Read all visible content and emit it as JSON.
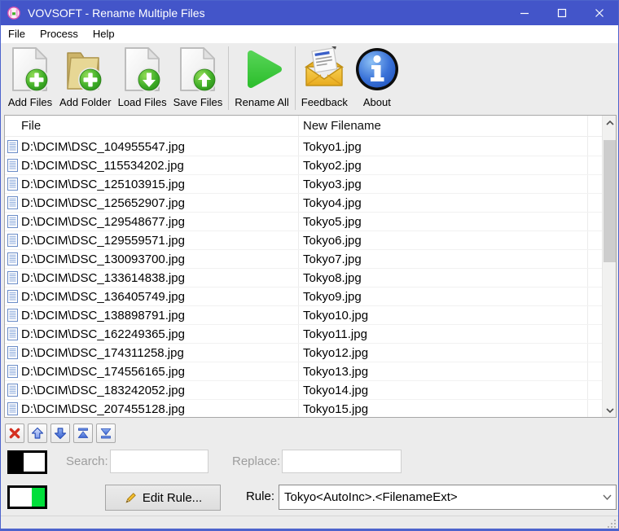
{
  "window": {
    "title": "VOVSOFT - Rename Multiple Files"
  },
  "menu": {
    "items": [
      {
        "label": "File"
      },
      {
        "label": "Process"
      },
      {
        "label": "Help"
      }
    ]
  },
  "toolbar": {
    "buttons": [
      {
        "label": "Add Files",
        "icon": "add-files-icon"
      },
      {
        "label": "Add Folder",
        "icon": "add-folder-icon"
      },
      {
        "label": "Load Files",
        "icon": "load-files-icon"
      },
      {
        "label": "Save Files",
        "icon": "save-files-icon"
      },
      {
        "label": "Rename All",
        "icon": "rename-all-icon"
      },
      {
        "label": "Feedback",
        "icon": "feedback-envelope-icon"
      },
      {
        "label": "About",
        "icon": "about-info-icon"
      }
    ]
  },
  "file_table": {
    "columns": [
      {
        "label": "File"
      },
      {
        "label": "New Filename"
      }
    ],
    "rows": [
      {
        "file": "D:\\DCIM\\DSC_104955547.jpg",
        "new_filename": "Tokyo1.jpg"
      },
      {
        "file": "D:\\DCIM\\DSC_115534202.jpg",
        "new_filename": "Tokyo2.jpg"
      },
      {
        "file": "D:\\DCIM\\DSC_125103915.jpg",
        "new_filename": "Tokyo3.jpg"
      },
      {
        "file": "D:\\DCIM\\DSC_125652907.jpg",
        "new_filename": "Tokyo4.jpg"
      },
      {
        "file": "D:\\DCIM\\DSC_129548677.jpg",
        "new_filename": "Tokyo5.jpg"
      },
      {
        "file": "D:\\DCIM\\DSC_129559571.jpg",
        "new_filename": "Tokyo6.jpg"
      },
      {
        "file": "D:\\DCIM\\DSC_130093700.jpg",
        "new_filename": "Tokyo7.jpg"
      },
      {
        "file": "D:\\DCIM\\DSC_133614838.jpg",
        "new_filename": "Tokyo8.jpg"
      },
      {
        "file": "D:\\DCIM\\DSC_136405749.jpg",
        "new_filename": "Tokyo9.jpg"
      },
      {
        "file": "D:\\DCIM\\DSC_138898791.jpg",
        "new_filename": "Tokyo10.jpg"
      },
      {
        "file": "D:\\DCIM\\DSC_162249365.jpg",
        "new_filename": "Tokyo11.jpg"
      },
      {
        "file": "D:\\DCIM\\DSC_174311258.jpg",
        "new_filename": "Tokyo12.jpg"
      },
      {
        "file": "D:\\DCIM\\DSC_174556165.jpg",
        "new_filename": "Tokyo13.jpg"
      },
      {
        "file": "D:\\DCIM\\DSC_183242052.jpg",
        "new_filename": "Tokyo14.jpg"
      },
      {
        "file": "D:\\DCIM\\DSC_207455128.jpg",
        "new_filename": "Tokyo15.jpg"
      }
    ]
  },
  "search_panel": {
    "search_label": "Search:",
    "search_value": "",
    "replace_label": "Replace:",
    "replace_value": ""
  },
  "rule_panel": {
    "edit_button_label": "Edit Rule...",
    "rule_label": "Rule:",
    "rule_value": "Tokyo<AutoInc>.<FilenameExt>"
  },
  "colors": {
    "titlebar": "#4355c9",
    "window_border": "#4d63cc",
    "accent_green": "#3fae27",
    "toggle_green": "#00df3a",
    "delete_red": "#d43020",
    "arrow_blue": "#4a72e0"
  }
}
